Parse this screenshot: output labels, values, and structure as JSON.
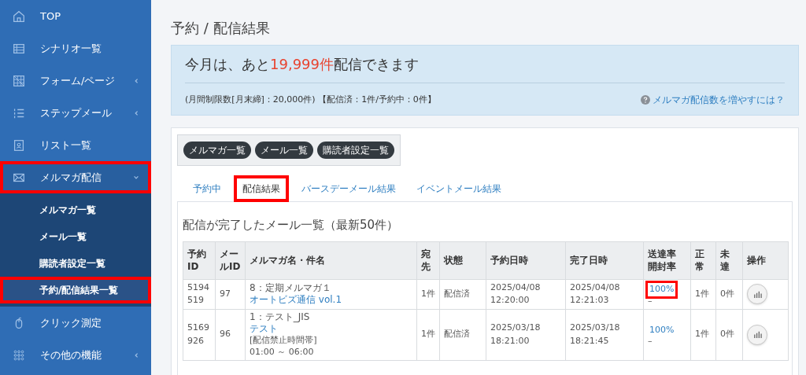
{
  "sidebar": {
    "items": [
      {
        "label": "TOP",
        "has_arrow": false,
        "highlighted": false,
        "expanded": false
      },
      {
        "label": "シナリオ一覧",
        "has_arrow": false,
        "highlighted": false,
        "expanded": false
      },
      {
        "label": "フォーム/ページ",
        "has_arrow": true,
        "highlighted": false,
        "expanded": false
      },
      {
        "label": "ステップメール",
        "has_arrow": true,
        "highlighted": false,
        "expanded": false
      },
      {
        "label": "リスト一覧",
        "has_arrow": false,
        "highlighted": false,
        "expanded": false
      },
      {
        "label": "メルマガ配信",
        "has_arrow": true,
        "highlighted": true,
        "expanded": true,
        "children": [
          {
            "label": "メルマガ一覧",
            "selected": false,
            "highlighted": false
          },
          {
            "label": "メール一覧",
            "selected": false,
            "highlighted": false
          },
          {
            "label": "購読者設定一覧",
            "selected": false,
            "highlighted": false
          },
          {
            "label": "予約/配信結果一覧",
            "selected": true,
            "highlighted": true
          }
        ]
      },
      {
        "label": "クリック測定",
        "has_arrow": false,
        "highlighted": false,
        "expanded": false
      },
      {
        "label": "その他の機能",
        "has_arrow": true,
        "highlighted": false,
        "expanded": false
      }
    ]
  },
  "page_title": "予約 / 配信結果",
  "quota": {
    "headline_before": "今月は、あと",
    "headline_count": "19,999件",
    "headline_after": "配信できます",
    "detail": "(月間制限数[月末締]：20,000件) 【配信済：1件/予約中：0件】",
    "help_link": "メルマガ配信数を増やすには？"
  },
  "quick_buttons": [
    "メルマガ一覧",
    "メール一覧",
    "購読者設定一覧"
  ],
  "tabs": [
    {
      "label": "予約中",
      "selected": false,
      "highlighted": false
    },
    {
      "label": "配信結果",
      "selected": true,
      "highlighted": true
    },
    {
      "label": "バースデーメール結果",
      "selected": false,
      "highlighted": false
    },
    {
      "label": "イベントメール結果",
      "selected": false,
      "highlighted": false
    }
  ],
  "section_title": "配信が完了したメール一覧（最新50件）",
  "table": {
    "columns": [
      "予約ID",
      "メールID",
      "メルマガ名・件名",
      "宛先",
      "状態",
      "予約日時",
      "完了日時",
      "送達率開封率",
      "正常",
      "未達",
      "操作"
    ],
    "rows": [
      {
        "reserve_id": "5194519",
        "mail_id": "97",
        "magazine": "8：定期メルマガ１",
        "subject": "オートビズ通信 vol.1",
        "recipients": "1件",
        "status": "配信済",
        "reserved_at": "2025/04/08 12:20:00",
        "completed_at": "2025/04/08 12:21:03",
        "delivery_rate": "100%",
        "open_rate": "–",
        "rate_highlighted": true,
        "ok": "1件",
        "failed": "0件"
      },
      {
        "reserve_id": "5169926",
        "mail_id": "96",
        "magazine": "1：テスト_JIS",
        "subject": "テスト",
        "notes": [
          "[配信禁止時間帯]",
          "01:00 ～ 06:00"
        ],
        "recipients": "1件",
        "status": "配信済",
        "reserved_at": "2025/03/18 18:21:00",
        "completed_at": "2025/03/18 18:21:45",
        "delivery_rate": "100%",
        "open_rate": "–",
        "rate_highlighted": false,
        "ok": "1件",
        "failed": "0件"
      }
    ]
  }
}
